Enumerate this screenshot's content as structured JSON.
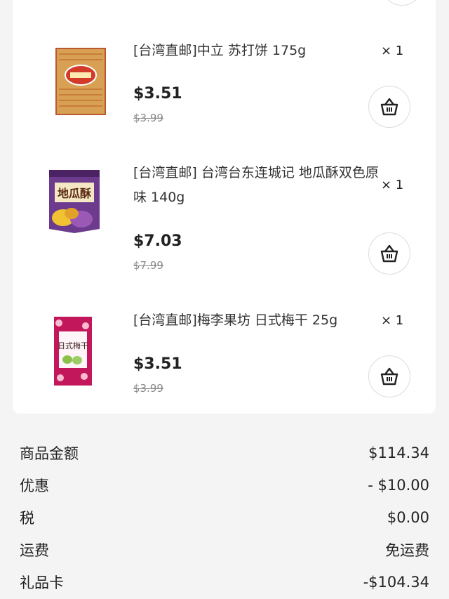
{
  "items": [
    {
      "title": "[台湾直邮]中立 苏打饼 175g",
      "qty": "× 1",
      "price": "$3.51",
      "original_price": "$3.99",
      "icon": "basket-icon"
    },
    {
      "title": "[台湾直邮] 台湾台东连城记 地瓜酥双色原味 140g",
      "qty": "× 1",
      "price": "$7.03",
      "original_price": "$7.99",
      "icon": "basket-icon"
    },
    {
      "title": "[台湾直邮]梅李果坊 日式梅干 25g",
      "qty": "× 1",
      "price": "$3.51",
      "original_price": "$3.99",
      "icon": "basket-icon"
    }
  ],
  "summary": {
    "subtotal_label": "商品金额",
    "subtotal_value": "$114.34",
    "discount_label": "优惠",
    "discount_value": "- $10.00",
    "tax_label": "税",
    "tax_value": "$0.00",
    "shipping_label": "运费",
    "shipping_value": "免运费",
    "giftcard_label": "礼品卡",
    "giftcard_value": "-$104.34"
  },
  "colors": {
    "background": "#f4f4f4",
    "card": "#ffffff",
    "text": "#222222",
    "muted": "#8a8a8a"
  }
}
